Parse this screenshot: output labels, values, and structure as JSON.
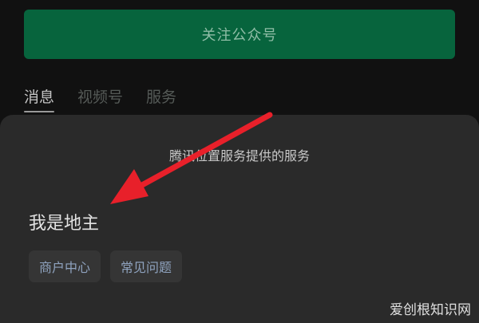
{
  "header": {
    "follow_button_label": "关注公众号"
  },
  "tabs": [
    {
      "label": "消息",
      "active": true
    },
    {
      "label": "视频号",
      "active": false
    },
    {
      "label": "服务",
      "active": false
    }
  ],
  "sheet": {
    "title": "腾讯位置服务提供的服务",
    "merchant_name": "我是地主",
    "chips": [
      {
        "label": "商户中心"
      },
      {
        "label": "常见问题"
      }
    ]
  },
  "annotation": {
    "arrow_color": "#e8202a",
    "watermark": "爱创根知识网"
  },
  "colors": {
    "background": "#111111",
    "button_green": "#07643d",
    "sheet_bg": "#2a2a2a",
    "chip_bg": "#353535",
    "chip_text": "#8fa3bf"
  }
}
